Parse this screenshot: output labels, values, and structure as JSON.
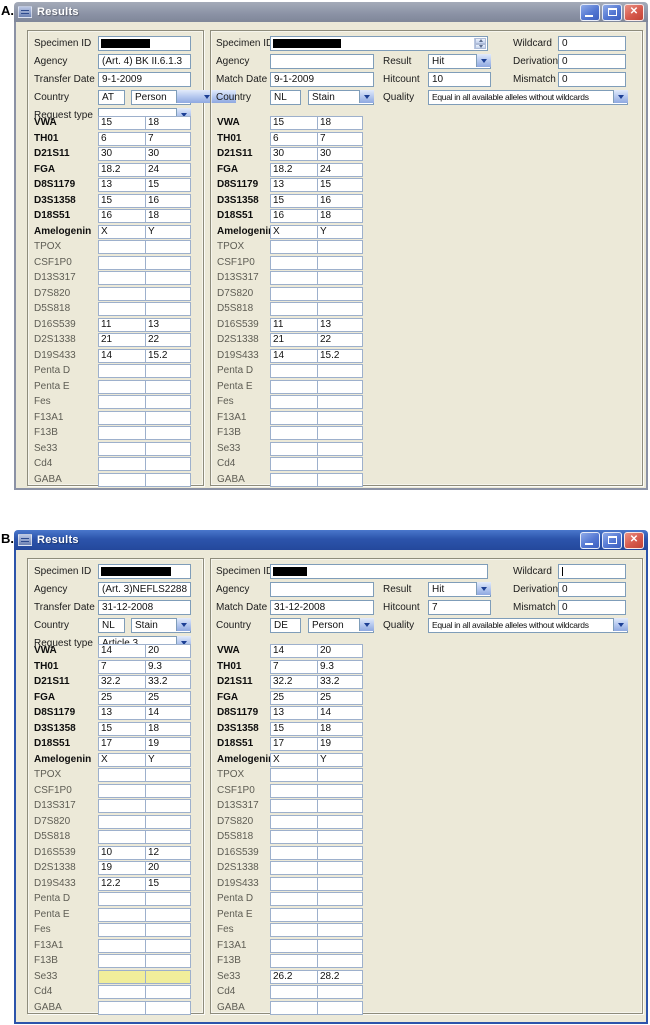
{
  "figure": {
    "label_a": "A.",
    "label_b": "B."
  },
  "colors": {
    "titlebar_active": "#2c54ab",
    "titlebar_inactive": "#8b92a5",
    "window_background": "#ece9d8",
    "field_border": "#7f9db9",
    "highlight_yellow": "#f1ee9b",
    "close_button_red": "#d6594c",
    "control_button_blue": "#5377d2"
  },
  "loci": {
    "bold_count": 8,
    "names": [
      "VWA",
      "TH01",
      "D21S11",
      "FGA",
      "D8S1179",
      "D3S1358",
      "D18S51",
      "Amelogenin",
      "TPOX",
      "CSF1P0",
      "D13S317",
      "D7S820",
      "D5S818",
      "D16S539",
      "D2S1338",
      "D19S433",
      "Penta D",
      "Penta E",
      "Fes",
      "F13A1",
      "F13B",
      "Se33",
      "Cd4",
      "GABA"
    ]
  },
  "titlebar_icons": {
    "minimize": "minimize-icon",
    "maximize": "maximize-icon",
    "close": "close-icon"
  },
  "windows": [
    {
      "title": "Results",
      "active": false,
      "left": {
        "specimen_id_label": "Specimen ID",
        "specimen_redacted": true,
        "agency_label": "Agency",
        "agency_value": "(Art. 4) BK II.6.1.3",
        "date_label": "Transfer Date",
        "date_value": "9-1-2009",
        "country_label": "Country",
        "country_code": "AT",
        "country_type": "Person",
        "request_label": "Request type",
        "request_value": "",
        "highlighted_loci": [],
        "alleles": [
          [
            "15",
            "18"
          ],
          [
            "6",
            "7"
          ],
          [
            "30",
            "30"
          ],
          [
            "18.2",
            "24"
          ],
          [
            "13",
            "15"
          ],
          [
            "15",
            "16"
          ],
          [
            "16",
            "18"
          ],
          [
            "X",
            "Y"
          ],
          null,
          null,
          null,
          null,
          null,
          [
            "11",
            "13"
          ],
          [
            "21",
            "22"
          ],
          [
            "14",
            "15.2"
          ],
          null,
          null,
          null,
          null,
          null,
          null,
          null,
          null
        ]
      },
      "right": {
        "specimen_id_label": "Specimen ID",
        "specimen_redacted": true,
        "has_spinner": true,
        "wildcard_caret": false,
        "agency_label": "Agency",
        "agency_value": "",
        "date_label": "Match Date",
        "date_value": "9-1-2009",
        "country_label": "Country",
        "country_code": "NL",
        "country_type": "Stain",
        "result_label": "Result",
        "result_value": "Hit",
        "hitcount_label": "Hitcount",
        "hitcount_value": "10",
        "quality_label": "Quality",
        "quality_value": "Equal in all available alleles without wildcards",
        "wildcard_label": "Wildcard",
        "wildcard_value": "0",
        "derivation_label": "Derivation",
        "derivation_value": "0",
        "mismatch_label": "Mismatch",
        "mismatch_value": "0",
        "highlighted_loci": [],
        "alleles": [
          [
            "15",
            "18"
          ],
          [
            "6",
            "7"
          ],
          [
            "30",
            "30"
          ],
          [
            "18.2",
            "24"
          ],
          [
            "13",
            "15"
          ],
          [
            "15",
            "16"
          ],
          [
            "16",
            "18"
          ],
          [
            "X",
            "Y"
          ],
          null,
          null,
          null,
          null,
          null,
          [
            "11",
            "13"
          ],
          [
            "21",
            "22"
          ],
          [
            "14",
            "15.2"
          ],
          null,
          null,
          null,
          null,
          null,
          null,
          null,
          null
        ]
      }
    },
    {
      "title": "Results",
      "active": true,
      "left": {
        "specimen_id_label": "Specimen ID",
        "specimen_redacted": true,
        "agency_label": "Agency",
        "agency_value": "(Art. 3)NEFLS2288",
        "date_label": "Transfer Date",
        "date_value": "31-12-2008",
        "country_label": "Country",
        "country_code": "NL",
        "country_type": "Stain",
        "request_label": "Request type",
        "request_value": "Article 3",
        "highlighted_loci": [
          "Se33"
        ],
        "alleles": [
          [
            "14",
            "20"
          ],
          [
            "7",
            "9.3"
          ],
          [
            "32.2",
            "33.2"
          ],
          [
            "25",
            "25"
          ],
          [
            "13",
            "14"
          ],
          [
            "15",
            "18"
          ],
          [
            "17",
            "19"
          ],
          [
            "X",
            "Y"
          ],
          null,
          null,
          null,
          null,
          null,
          [
            "10",
            "12"
          ],
          [
            "19",
            "20"
          ],
          [
            "12.2",
            "15"
          ],
          null,
          null,
          null,
          null,
          null,
          null,
          null,
          null
        ]
      },
      "right": {
        "specimen_id_label": "Specimen ID",
        "specimen_redacted": true,
        "has_spinner": false,
        "wildcard_caret": true,
        "agency_label": "Agency",
        "agency_value": "",
        "date_label": "Match Date",
        "date_value": "31-12-2008",
        "country_label": "Country",
        "country_code": "DE",
        "country_type": "Person",
        "result_label": "Result",
        "result_value": "Hit",
        "hitcount_label": "Hitcount",
        "hitcount_value": "7",
        "quality_label": "Quality",
        "quality_value": "Equal in all available alleles without wildcards",
        "wildcard_label": "Wildcard",
        "wildcard_value": "",
        "derivation_label": "Derivation",
        "derivation_value": "0",
        "mismatch_label": "Mismatch",
        "mismatch_value": "0",
        "highlighted_loci": [],
        "alleles": [
          [
            "14",
            "20"
          ],
          [
            "7",
            "9.3"
          ],
          [
            "32.2",
            "33.2"
          ],
          [
            "25",
            "25"
          ],
          [
            "13",
            "14"
          ],
          [
            "15",
            "18"
          ],
          [
            "17",
            "19"
          ],
          [
            "X",
            "Y"
          ],
          null,
          null,
          null,
          null,
          null,
          null,
          null,
          null,
          null,
          null,
          null,
          null,
          null,
          [
            "26.2",
            "28.2"
          ],
          null,
          null
        ]
      }
    }
  ]
}
